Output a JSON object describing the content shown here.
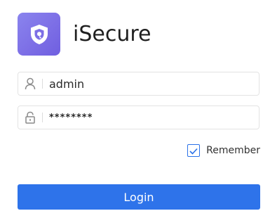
{
  "app": {
    "name": "iSecure",
    "logo_icon": "shield-icon",
    "logo_color": "#7d6fe6"
  },
  "form": {
    "username": {
      "value": "admin",
      "icon": "user-icon"
    },
    "password": {
      "value": "********",
      "icon": "lock-icon"
    },
    "remember": {
      "label": "Remember",
      "checked": true
    },
    "login_label": "Login"
  },
  "colors": {
    "accent": "#2e73ea",
    "border": "#e3e3e3",
    "text": "#1f1f1f"
  }
}
